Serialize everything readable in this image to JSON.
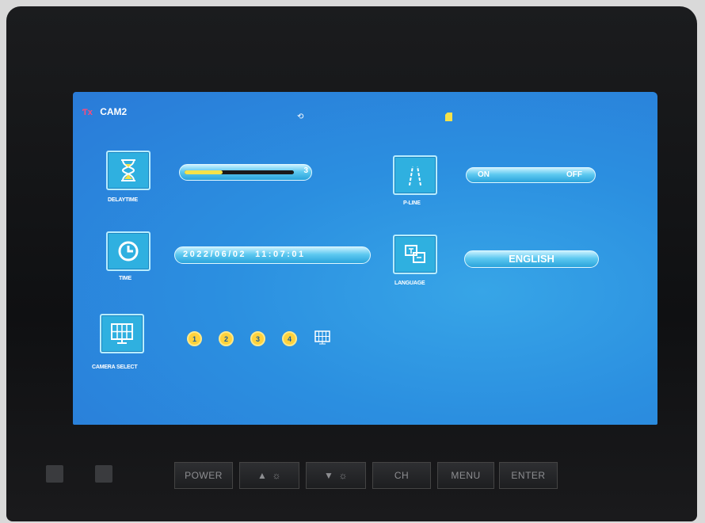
{
  "status": {
    "camera": "CAM2"
  },
  "menu": {
    "delaytime": {
      "label": "DELAYTIME",
      "value": "3",
      "level": 0.35
    },
    "pline": {
      "label": "P-LINE",
      "on": "ON",
      "off": "OFF"
    },
    "time": {
      "label": "TIME",
      "value": "2022/06/02  11:07:01"
    },
    "language": {
      "label": "LANGUAGE",
      "value": "ENGLISH"
    },
    "camera_select": {
      "label": "CAMERA SELECT",
      "cams": [
        "1",
        "2",
        "3",
        "4"
      ]
    }
  },
  "hardware_buttons": {
    "power": "POWER",
    "bright_up": "▲",
    "bright_down": "▼",
    "ch": "CH",
    "menu": "MENU",
    "enter": "ENTER"
  },
  "colors": {
    "screen": "#2a86dd",
    "accent": "#f4e24a",
    "tile": "#2fb0e0"
  }
}
